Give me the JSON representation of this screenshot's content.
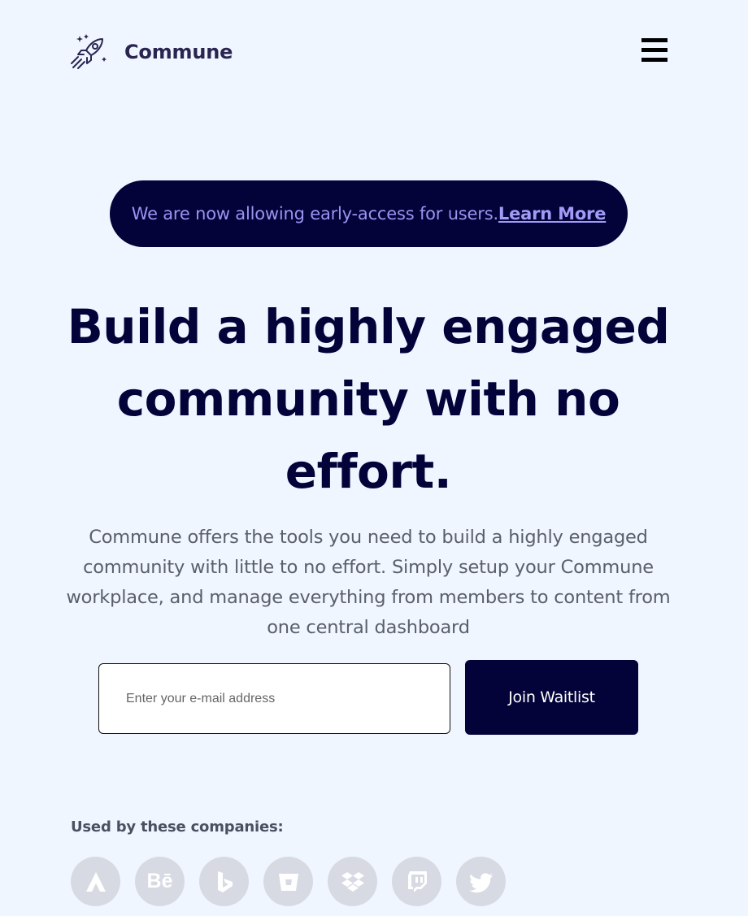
{
  "header": {
    "brand_name": "Commune",
    "logo_icon": "rocket-icon",
    "menu_icon": "hamburger-menu-icon"
  },
  "banner": {
    "text": "We are now allowing early-access for users.",
    "link_label": "Learn More"
  },
  "hero": {
    "headline": "Build a highly engaged community with no effort.",
    "description": "Commune offers the tools you need to build a highly engaged community with little to no effort. Simply setup your Commune workplace, and manage everything from members to content from one central dashboard"
  },
  "waitlist": {
    "email_placeholder": "Enter your e-mail address",
    "email_value": "",
    "button_label": "Join Waitlist"
  },
  "companies": {
    "label": "Used by these companies:",
    "logos": [
      "atlassian-icon",
      "behance-icon",
      "bing-icon",
      "bitbucket-icon",
      "dropbox-icon",
      "twitch-icon",
      "twitter-icon"
    ],
    "behance_text": "Bē"
  },
  "colors": {
    "background": "#eff6ff",
    "primary_dark": "#03033a",
    "banner_text": "#9b93f0",
    "muted_text": "#5b5f6b",
    "company_logo_bg": "#d7dae3"
  }
}
